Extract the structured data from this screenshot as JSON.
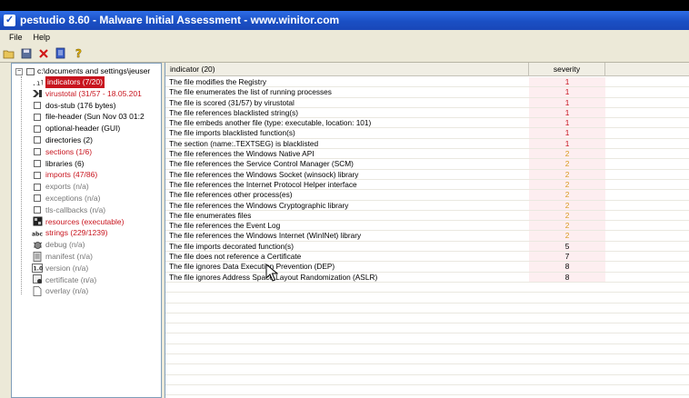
{
  "window": {
    "title": "pestudio 8.60 - Malware Initial Assessment - www.winitor.com",
    "title_icon": "check-icon"
  },
  "menu": [
    "File",
    "Help"
  ],
  "toolbar": {
    "icons": [
      "open-folder-icon",
      "save-icon",
      "delete-icon",
      "document-icon",
      "info-icon"
    ]
  },
  "tree": {
    "root": "c:\\documents and settings\\jeuser",
    "items": [
      {
        "label": "indicators (7/20)",
        "style": "selected",
        "icon": "indicators-icon"
      },
      {
        "label": "virustotal (31/57 - 18.05.201",
        "style": "red",
        "icon": "virustotal-icon"
      },
      {
        "label": "dos-stub (176 bytes)",
        "style": "normal",
        "icon": "section-icon"
      },
      {
        "label": "file-header (Sun Nov 03 01:2",
        "style": "normal",
        "icon": "section-icon"
      },
      {
        "label": "optional-header (GUI)",
        "style": "normal",
        "icon": "section-icon"
      },
      {
        "label": "directories (2)",
        "style": "normal",
        "icon": "section-icon"
      },
      {
        "label": "sections (1/6)",
        "style": "red",
        "icon": "section-icon"
      },
      {
        "label": "libraries (6)",
        "style": "normal",
        "icon": "section-icon"
      },
      {
        "label": "imports (47/86)",
        "style": "red",
        "icon": "section-icon"
      },
      {
        "label": "exports (n/a)",
        "style": "gray",
        "icon": "section-icon"
      },
      {
        "label": "exceptions (n/a)",
        "style": "gray",
        "icon": "section-icon"
      },
      {
        "label": "tls-callbacks (n/a)",
        "style": "gray",
        "icon": "section-icon"
      },
      {
        "label": "resources (executable)",
        "style": "red",
        "icon": "resources-icon"
      },
      {
        "label": "strings (229/1239)",
        "style": "red",
        "icon": "strings-icon"
      },
      {
        "label": "debug (n/a)",
        "style": "gray",
        "icon": "debug-icon"
      },
      {
        "label": "manifest (n/a)",
        "style": "gray",
        "icon": "manifest-icon"
      },
      {
        "label": "version (n/a)",
        "style": "gray",
        "icon": "version-icon"
      },
      {
        "label": "certificate (n/a)",
        "style": "gray",
        "icon": "certificate-icon"
      },
      {
        "label": "overlay (n/a)",
        "style": "gray",
        "icon": "overlay-icon"
      }
    ]
  },
  "grid": {
    "columns": {
      "indicator": "indicator (20)",
      "severity": "severity"
    },
    "rows": [
      {
        "indicator": "The file modifies the Registry",
        "severity": "1"
      },
      {
        "indicator": "The file enumerates the list of running processes",
        "severity": "1"
      },
      {
        "indicator": "The file is scored (31/57) by virustotal",
        "severity": "1"
      },
      {
        "indicator": "The file references blacklisted string(s)",
        "severity": "1"
      },
      {
        "indicator": "The file embeds another file (type: executable, location: 101)",
        "severity": "1"
      },
      {
        "indicator": "The file imports blacklisted function(s)",
        "severity": "1"
      },
      {
        "indicator": "The section (name:.TEXTSEG) is blacklisted",
        "severity": "1"
      },
      {
        "indicator": "The file references the Windows Native API",
        "severity": "2"
      },
      {
        "indicator": "The file references the Service Control Manager (SCM)",
        "severity": "2"
      },
      {
        "indicator": "The file references the Windows Socket (winsock) library",
        "severity": "2"
      },
      {
        "indicator": "The file references the Internet Protocol Helper interface",
        "severity": "2"
      },
      {
        "indicator": "The file references other process(es)",
        "severity": "2"
      },
      {
        "indicator": "The file references the Windows Cryptographic library",
        "severity": "2"
      },
      {
        "indicator": "The file enumerates files",
        "severity": "2"
      },
      {
        "indicator": "The file references the Event Log",
        "severity": "2"
      },
      {
        "indicator": "The file references the Windows Internet (WinINet) library",
        "severity": "2"
      },
      {
        "indicator": "The file imports decorated function(s)",
        "severity": "5"
      },
      {
        "indicator": "The file does not reference a Certificate",
        "severity": "7"
      },
      {
        "indicator": "The file ignores Data Execution Prevention (DEP)",
        "severity": "8"
      },
      {
        "indicator": "The file ignores Address Space Layout Randomization (ASLR)",
        "severity": "8"
      }
    ],
    "empty_rows": 11
  },
  "colors": {
    "severity_high": "#c8141e",
    "severity_medium": "#d99a1e",
    "titlebar": "#1a4fc4"
  }
}
